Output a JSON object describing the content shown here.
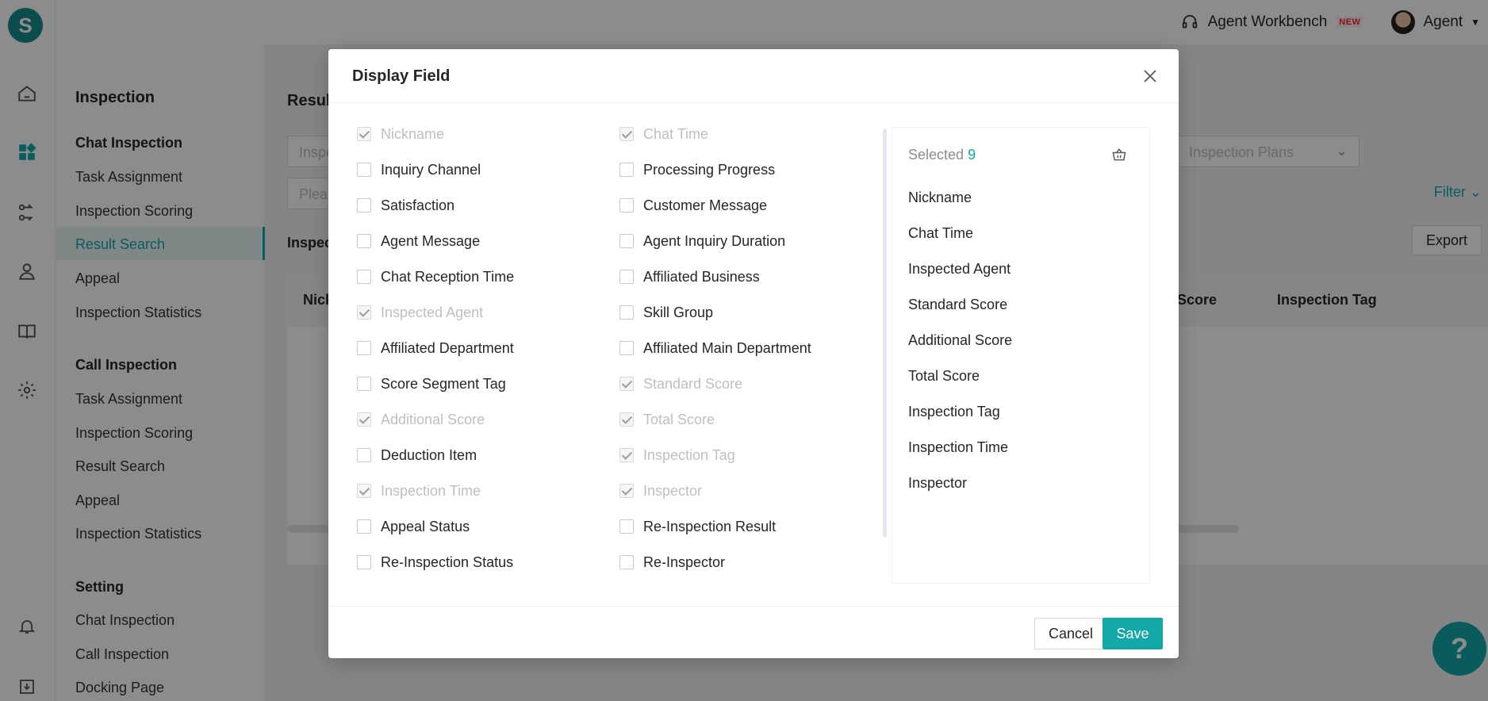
{
  "app": {
    "logo_letter": "S",
    "workbench_label": "Agent Workbench",
    "new_badge": "NEW",
    "user_label": "Agent",
    "accent_color": "#13a8a8"
  },
  "subnav": {
    "title": "Inspection",
    "sections": [
      {
        "label": "Chat Inspection",
        "items": [
          "Task Assignment",
          "Inspection Scoring",
          "Result Search",
          "Appeal",
          "Inspection Statistics"
        ]
      },
      {
        "label": "Call Inspection",
        "items": [
          "Task Assignment",
          "Inspection Scoring",
          "Result Search",
          "Appeal",
          "Inspection Statistics"
        ]
      },
      {
        "label": "Setting",
        "items": [
          "Chat Inspection",
          "Call Inspection",
          "Docking Page"
        ]
      }
    ],
    "active_item": "Result Search"
  },
  "main": {
    "page_title": "Result",
    "input_one": "Inspe",
    "input_two": "Pleas",
    "plans_placeholder": "Inspection Plans",
    "filter_label": "Filter",
    "export_label": "Export",
    "section_label": "Inspec",
    "table_headers": [
      "Nick",
      "Score",
      "Inspection Tag"
    ]
  },
  "modal": {
    "title": "Display Field",
    "fields_left": [
      {
        "label": "Nickname",
        "checked": true,
        "disabled": true
      },
      {
        "label": "Inquiry Channel",
        "checked": false,
        "disabled": false
      },
      {
        "label": "Satisfaction",
        "checked": false,
        "disabled": false
      },
      {
        "label": "Agent Message",
        "checked": false,
        "disabled": false
      },
      {
        "label": "Chat Reception Time",
        "checked": false,
        "disabled": false
      },
      {
        "label": "Inspected Agent",
        "checked": true,
        "disabled": true
      },
      {
        "label": "Affiliated Department",
        "checked": false,
        "disabled": false
      },
      {
        "label": "Score Segment Tag",
        "checked": false,
        "disabled": false
      },
      {
        "label": "Additional Score",
        "checked": true,
        "disabled": true
      },
      {
        "label": "Deduction Item",
        "checked": false,
        "disabled": false
      },
      {
        "label": "Inspection Time",
        "checked": true,
        "disabled": true
      },
      {
        "label": "Appeal Status",
        "checked": false,
        "disabled": false
      },
      {
        "label": "Re-Inspection Status",
        "checked": false,
        "disabled": false
      }
    ],
    "fields_right": [
      {
        "label": "Chat Time",
        "checked": true,
        "disabled": true
      },
      {
        "label": "Processing Progress",
        "checked": false,
        "disabled": false
      },
      {
        "label": "Customer Message",
        "checked": false,
        "disabled": false
      },
      {
        "label": "Agent Inquiry Duration",
        "checked": false,
        "disabled": false
      },
      {
        "label": "Affiliated Business",
        "checked": false,
        "disabled": false
      },
      {
        "label": "Skill Group",
        "checked": false,
        "disabled": false
      },
      {
        "label": "Affiliated Main Department",
        "checked": false,
        "disabled": false
      },
      {
        "label": "Standard Score",
        "checked": true,
        "disabled": true
      },
      {
        "label": "Total Score",
        "checked": true,
        "disabled": true
      },
      {
        "label": "Inspection Tag",
        "checked": true,
        "disabled": true
      },
      {
        "label": "Inspector",
        "checked": true,
        "disabled": true
      },
      {
        "label": "Re-Inspection Result",
        "checked": false,
        "disabled": false
      },
      {
        "label": "Re-Inspector",
        "checked": false,
        "disabled": false
      }
    ],
    "selected_label": "Selected",
    "selected_count": "9",
    "selected_items": [
      "Nickname",
      "Chat Time",
      "Inspected Agent",
      "Standard Score",
      "Additional Score",
      "Total Score",
      "Inspection Tag",
      "Inspection Time",
      "Inspector"
    ],
    "cancel_label": "Cancel",
    "save_label": "Save"
  }
}
